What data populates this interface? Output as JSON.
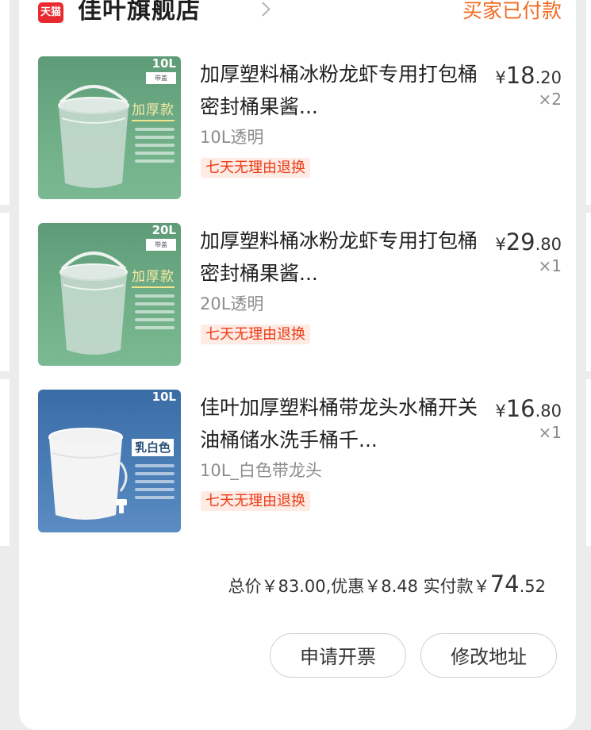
{
  "store": {
    "badge": "天猫",
    "name": "佳叶旗舰店",
    "status": "买家已付款"
  },
  "items": [
    {
      "title": "加厚塑料桶冰粉龙虾专用打包桶密封桶果酱...",
      "variant": "10L透明",
      "tag": "七天无理由退换",
      "price_symbol": "¥",
      "price_int": "18",
      "price_dec": ".20",
      "qty": "×2",
      "image": {
        "volume": "10L",
        "sub": "带盖",
        "style": "加厚款",
        "color": "#6aa883"
      }
    },
    {
      "title": "加厚塑料桶冰粉龙虾专用打包桶密封桶果酱...",
      "variant": "20L透明",
      "tag": "七天无理由退换",
      "price_symbol": "¥",
      "price_int": "29",
      "price_dec": ".80",
      "qty": "×1",
      "image": {
        "volume": "20L",
        "sub": "带盖",
        "style": "加厚款",
        "color": "#6aa883"
      }
    },
    {
      "title": "佳叶加厚塑料桶带龙头水桶开关油桶储水洗手桶千...",
      "variant": "10L_白色带龙头",
      "tag": "七天无理由退换",
      "price_symbol": "¥",
      "price_int": "16",
      "price_dec": ".80",
      "qty": "×1",
      "image": {
        "volume": "10L",
        "style": "乳白色",
        "color": "#4a7db5"
      }
    }
  ],
  "summary": {
    "text": "总价￥83.00,优惠￥8.48 实付款￥",
    "paid_int": "74",
    "paid_dec": ".52"
  },
  "actions": {
    "invoice": "申请开票",
    "address": "修改地址"
  },
  "colors": {
    "accent": "#f26b22",
    "tmall_red": "#e8292f",
    "tag_text": "#ee3b17",
    "tag_bg": "#fdebe4"
  }
}
